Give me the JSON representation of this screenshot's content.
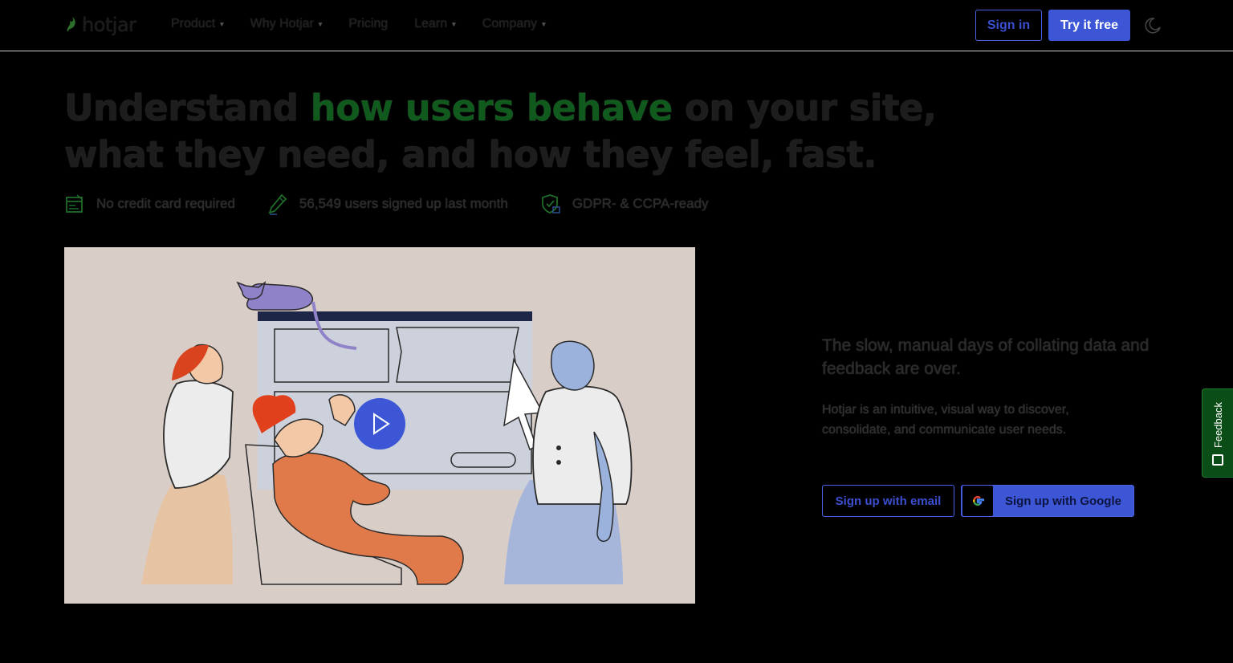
{
  "nav": {
    "logo_text": "hotjar",
    "menu": [
      {
        "label": "Product",
        "has_dropdown": true
      },
      {
        "label": "Why Hotjar",
        "has_dropdown": true
      },
      {
        "label": "Pricing",
        "has_dropdown": false
      },
      {
        "label": "Learn",
        "has_dropdown": true
      },
      {
        "label": "Company",
        "has_dropdown": true
      }
    ],
    "sign_in_label": "Sign in",
    "try_free_label": "Try it free",
    "theme_toggle_icon": "moon-icon"
  },
  "hero": {
    "headline_before": "Understand ",
    "headline_highlight": "how users behave",
    "headline_after": " on your site, what they need, and how they feel, fast.",
    "badges": [
      {
        "icon": "credit-card-icon",
        "label": "No credit card required"
      },
      {
        "icon": "pencil-icon",
        "label": "56,549 users signed up last month"
      },
      {
        "icon": "shield-check-icon",
        "label": "GDPR- & CCPA-ready"
      }
    ]
  },
  "video": {
    "play_icon": "play-icon"
  },
  "copy": {
    "subheading": "The slow, manual days of collating data and feedback are over.",
    "description": "Hotjar is an intuitive, visual way to discover, consolidate, and communicate user needs.",
    "signup_email_label": "Sign up with email",
    "signup_google_label": "Sign up with Google"
  },
  "feedback_tab": {
    "label": "Feedback"
  },
  "colors": {
    "background": "#000000",
    "accent_blue": "#3c56d6",
    "highlight_green": "#0f5a1c",
    "illustration_bg": "#d9cdc8",
    "feedback_green": "#0b4d17"
  }
}
